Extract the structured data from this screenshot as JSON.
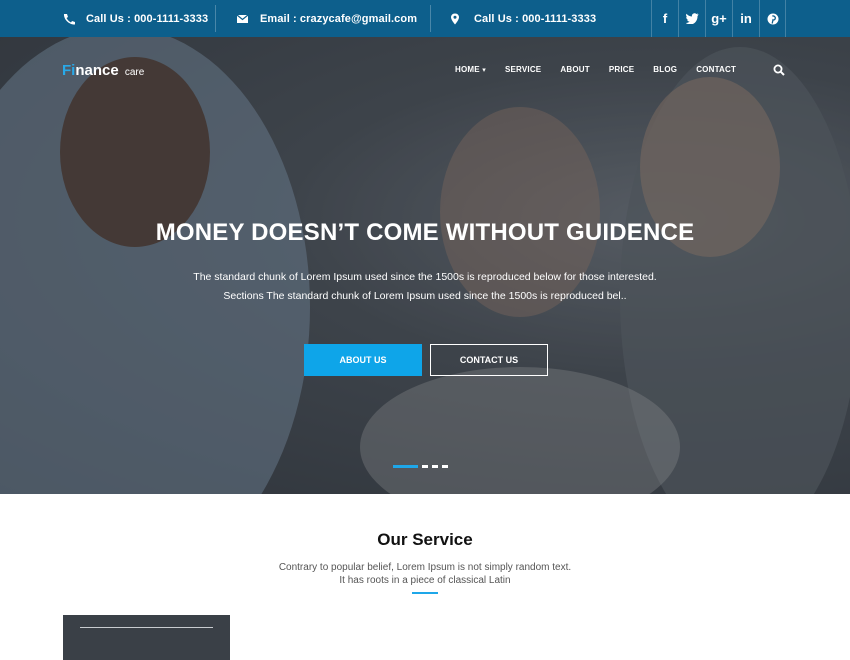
{
  "topbar": {
    "phone1": "Call Us : 000-1111-3333",
    "email": "Email : crazycafe@gmail.com",
    "phone2": "Call Us : 000-1111-3333",
    "social": [
      "f",
      "t",
      "g+",
      "in",
      "p"
    ]
  },
  "logo": {
    "brand_first": "Fi",
    "brand_rest": "nance",
    "brand_suffix": "care"
  },
  "nav": {
    "items": [
      "HOME",
      "SERVICE",
      "ABOUT",
      "PRICE",
      "BLOG",
      "CONTACT"
    ],
    "home_caret": "▾"
  },
  "hero": {
    "title": "MONEY DOESN’T COME WITHOUT GUIDENCE",
    "line1": "The standard chunk of Lorem Ipsum used since the 1500s is reproduced below for those interested.",
    "line2": "Sections The standard chunk of Lorem Ipsum used since the 1500s is reproduced bel..",
    "about_btn": "ABOUT US",
    "contact_btn": "CONTACT US",
    "slide_count": 4,
    "active_slide": 1
  },
  "service": {
    "title": "Our Service",
    "line1": "Contrary to popular belief, Lorem Ipsum is not simply random text.",
    "line2": "It has roots in a piece of classical Latin"
  },
  "colors": {
    "topbar": "#0d5f8c",
    "accent": "#0ea5e9"
  }
}
